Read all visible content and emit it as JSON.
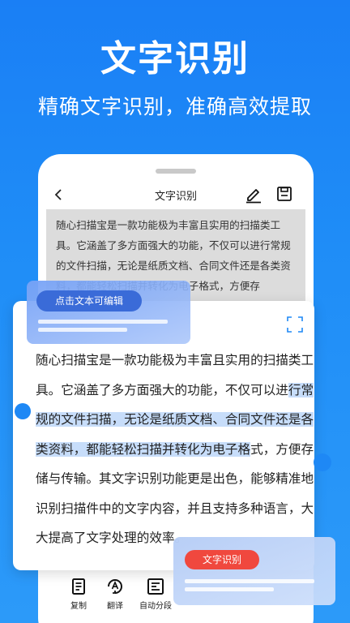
{
  "hero": {
    "title": "文字识别",
    "subtitle": "精确文字识别，准确高效提取"
  },
  "phone": {
    "header": {
      "title": "文字识别",
      "back_icon": "chevron-left-icon",
      "edit_icon": "pen-edit-icon",
      "save_icon": "save-icon"
    },
    "scan_text": "随心扫描宝是一款功能极为丰富且实用的扫描类工具。它涵盖了多方面强大的功能，不仅可以进行常规的文件扫描，无论是纸质文档、合同文件还是各类资料，都能轻松扫描并转化为电子格式，方便存"
  },
  "badge": {
    "label": "点击文本可编辑"
  },
  "result": {
    "expand_icon": "expand-corners-icon",
    "segments": [
      "随心扫描宝是一款功能极为丰富且实用的扫描类工具。它涵盖了多方面强大的功能，不仅可以进",
      "行常规的文件扫描，无论是纸质文档、合同文件还是各类资料，都能轻松扫描并转化为电子格",
      "式，方便存储与传输。其文字识别功能更是出色，能够精准地识别扫描件中的文字内容，并且支持多种语言，大大提高了文字处理的效率。"
    ]
  },
  "toolbar": {
    "items": [
      {
        "label": "复制",
        "icon": "copy-document-icon"
      },
      {
        "label": "翻译",
        "icon": "translate-icon"
      },
      {
        "label": "自动分段",
        "icon": "auto-paragraph-icon"
      }
    ]
  },
  "ocr_badge": {
    "label": "文字识别"
  },
  "colors": {
    "background": "#1f8df7",
    "accent_blue": "#1e88f5",
    "highlight": "#c7ddfa",
    "badge_blue": "#3a6bd8",
    "badge_red": "#f0483e"
  }
}
